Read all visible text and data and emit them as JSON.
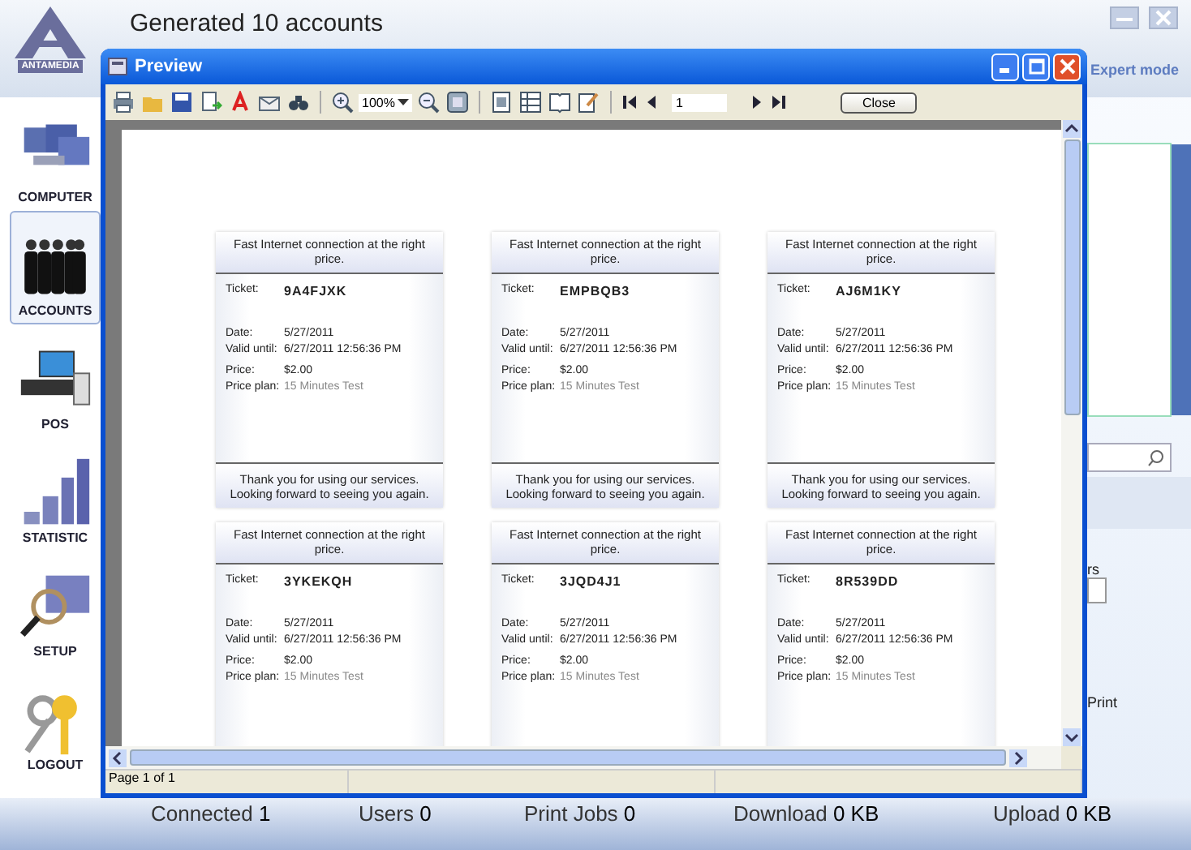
{
  "app": {
    "logo": "ANTAMEDIA",
    "title": "Generated 10 accounts",
    "expert_mode": "Expert mode",
    "side_label": "rs",
    "print_label": "Print"
  },
  "sidebar": {
    "items": [
      {
        "label": "COMPUTER",
        "selected": false
      },
      {
        "label": "ACCOUNTS",
        "selected": true
      },
      {
        "label": "POS",
        "selected": false
      },
      {
        "label": "STATISTIC",
        "selected": false
      },
      {
        "label": "SETUP",
        "selected": false
      },
      {
        "label": "LOGOUT",
        "selected": false
      }
    ]
  },
  "preview": {
    "title": "Preview",
    "zoom": "100%",
    "page_input": "1",
    "close_button": "Close",
    "status": "Page 1 of 1",
    "tickets": [
      {
        "header": "Fast Internet connection at the right price.",
        "ticket_label": "Ticket:",
        "code": "9A4FJXK",
        "date_label": "Date:",
        "date": "5/27/2011",
        "valid_label": "Valid until:",
        "valid": "6/27/2011 12:56:36 PM",
        "price_label": "Price:",
        "price": "$2.00",
        "plan_label": "Price plan:",
        "plan": "15 Minutes Test",
        "footer": "Thank you for using our services. Looking forward to seeing you again."
      },
      {
        "header": "Fast Internet connection at the right price.",
        "ticket_label": "Ticket:",
        "code": "EMPBQB3",
        "date_label": "Date:",
        "date": "5/27/2011",
        "valid_label": "Valid until:",
        "valid": "6/27/2011 12:56:36 PM",
        "price_label": "Price:",
        "price": "$2.00",
        "plan_label": "Price plan:",
        "plan": "15 Minutes Test",
        "footer": "Thank you for using our services. Looking forward to seeing you again."
      },
      {
        "header": "Fast Internet connection at the right price.",
        "ticket_label": "Ticket:",
        "code": "AJ6M1KY",
        "date_label": "Date:",
        "date": "5/27/2011",
        "valid_label": "Valid until:",
        "valid": "6/27/2011 12:56:36 PM",
        "price_label": "Price:",
        "price": "$2.00",
        "plan_label": "Price plan:",
        "plan": "15 Minutes Test",
        "footer": "Thank you for using our services. Looking forward to seeing you again."
      },
      {
        "header": "Fast Internet connection at the right price.",
        "ticket_label": "Ticket:",
        "code": "3YKEKQH",
        "date_label": "Date:",
        "date": "5/27/2011",
        "valid_label": "Valid until:",
        "valid": "6/27/2011 12:56:36 PM",
        "price_label": "Price:",
        "price": "$2.00",
        "plan_label": "Price plan:",
        "plan": "15 Minutes Test"
      },
      {
        "header": "Fast Internet connection at the right price.",
        "ticket_label": "Ticket:",
        "code": "3JQD4J1",
        "date_label": "Date:",
        "date": "5/27/2011",
        "valid_label": "Valid until:",
        "valid": "6/27/2011 12:56:36 PM",
        "price_label": "Price:",
        "price": "$2.00",
        "plan_label": "Price plan:",
        "plan": "15 Minutes Test"
      },
      {
        "header": "Fast Internet connection at the right price.",
        "ticket_label": "Ticket:",
        "code": "8R539DD",
        "date_label": "Date:",
        "date": "5/27/2011",
        "valid_label": "Valid until:",
        "valid": "6/27/2011 12:56:36 PM",
        "price_label": "Price:",
        "price": "$2.00",
        "plan_label": "Price plan:",
        "plan": "15 Minutes Test"
      }
    ]
  },
  "status_bar": [
    {
      "label": "Connected",
      "value": "1"
    },
    {
      "label": "Users",
      "value": "0"
    },
    {
      "label": "Print Jobs",
      "value": "0"
    },
    {
      "label": "Download",
      "value": "0 KB"
    },
    {
      "label": "Upload",
      "value": "0 KB"
    }
  ]
}
